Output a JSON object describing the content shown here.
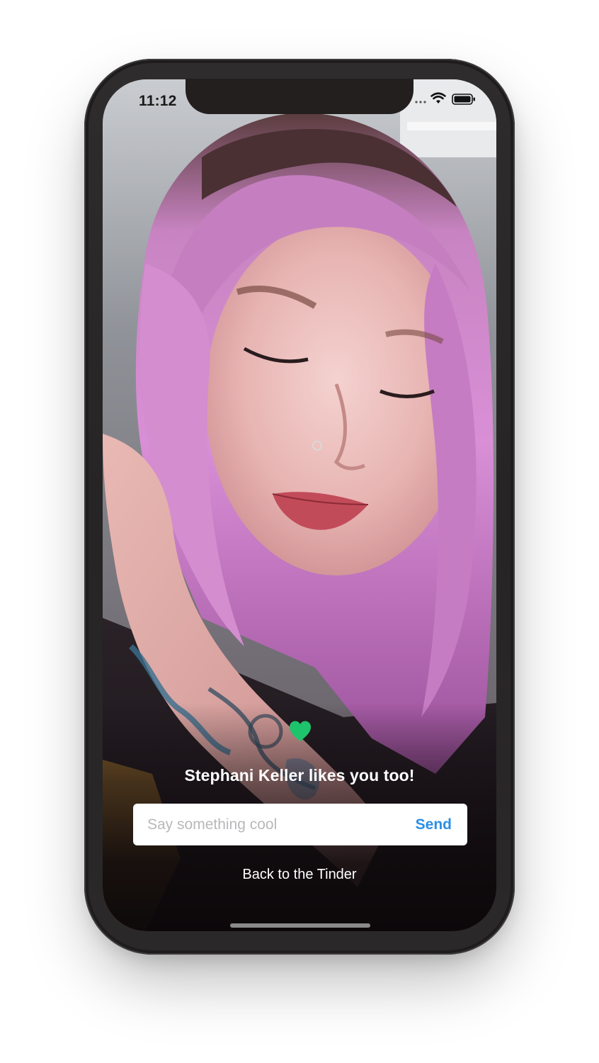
{
  "status_bar": {
    "time": "11:12",
    "icons": [
      "wifi-icon",
      "battery-icon"
    ]
  },
  "match": {
    "icon": "heart-icon",
    "heart_color": "#1ec46b",
    "title": "Stephani Keller likes you too!"
  },
  "message": {
    "placeholder": "Say something cool",
    "value": "",
    "send_label": "Send",
    "send_color": "#2a8fe6"
  },
  "footer": {
    "back_label": "Back to the Tinder"
  }
}
